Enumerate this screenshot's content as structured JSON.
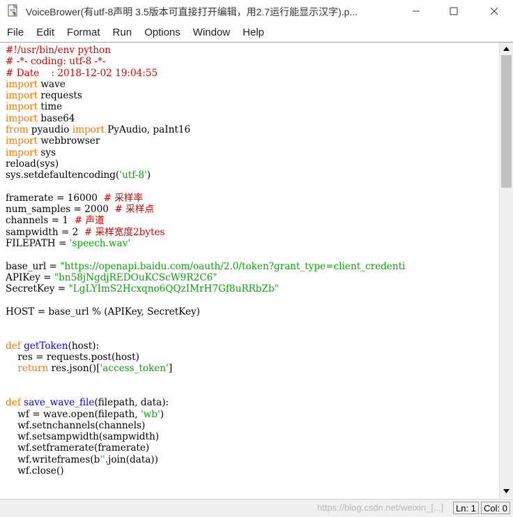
{
  "window": {
    "title": "VoiceBrower(有utf-8声明 3.5版本可直接打开编辑，用2.7运行能显示汉字).p..."
  },
  "menu": [
    "File",
    "Edit",
    "Format",
    "Run",
    "Options",
    "Window",
    "Help"
  ],
  "code_lines": [
    [
      [
        "comment",
        "#!/usr/bin/env python"
      ]
    ],
    [
      [
        "comment",
        "# -*- coding: utf-8 -*-"
      ]
    ],
    [
      [
        "comment",
        "# Date    : 2018-12-02 19:04:55"
      ]
    ],
    [
      [
        "keyword",
        "import"
      ],
      [
        "plain",
        " wave"
      ]
    ],
    [
      [
        "keyword",
        "import"
      ],
      [
        "plain",
        " requests"
      ]
    ],
    [
      [
        "keyword",
        "import"
      ],
      [
        "plain",
        " time"
      ]
    ],
    [
      [
        "keyword",
        "import"
      ],
      [
        "plain",
        " base64"
      ]
    ],
    [
      [
        "keyword",
        "from"
      ],
      [
        "plain",
        " pyaudio "
      ],
      [
        "keyword",
        "import"
      ],
      [
        "plain",
        " PyAudio, paInt16"
      ]
    ],
    [
      [
        "keyword",
        "import"
      ],
      [
        "plain",
        " webbrowser"
      ]
    ],
    [
      [
        "keyword",
        "import"
      ],
      [
        "plain",
        " sys"
      ]
    ],
    [
      [
        "plain",
        "reload(sys)"
      ]
    ],
    [
      [
        "plain",
        "sys.setdefaultencoding("
      ],
      [
        "string",
        "'utf-8'"
      ],
      [
        "plain",
        ")"
      ]
    ],
    [],
    [
      [
        "plain",
        "framerate = 16000  "
      ],
      [
        "comment",
        "# 采样率"
      ]
    ],
    [
      [
        "plain",
        "num_samples = 2000  "
      ],
      [
        "comment",
        "# 采样点"
      ]
    ],
    [
      [
        "plain",
        "channels = 1  "
      ],
      [
        "comment",
        "# 声道"
      ]
    ],
    [
      [
        "plain",
        "sampwidth = 2  "
      ],
      [
        "comment",
        "# 采样宽度2bytes"
      ]
    ],
    [
      [
        "plain",
        "FILEPATH = "
      ],
      [
        "string",
        "'speech.wav'"
      ]
    ],
    [],
    [
      [
        "plain",
        "base_url = "
      ],
      [
        "string",
        "\"https://openapi.baidu.com/oauth/2.0/token?grant_type=client_credenti"
      ]
    ],
    [
      [
        "plain",
        "APIKey = "
      ],
      [
        "string",
        "\"bn58jNgdjREDOuKCScW9R2C6\""
      ]
    ],
    [
      [
        "plain",
        "SecretKey = "
      ],
      [
        "string",
        "\"LgLYImS2Hcxqno6QQzIMrH7Gf8uRRbZb\""
      ]
    ],
    [],
    [
      [
        "plain",
        "HOST = base_url % (APIKey, SecretKey)"
      ]
    ],
    [],
    [],
    [
      [
        "keyword",
        "def"
      ],
      [
        "plain",
        " "
      ],
      [
        "def",
        "getToken"
      ],
      [
        "plain",
        "(host):"
      ]
    ],
    [
      [
        "plain",
        "    res = requests.post(host)"
      ]
    ],
    [
      [
        "plain",
        "    "
      ],
      [
        "keyword",
        "return"
      ],
      [
        "plain",
        " res.json()["
      ],
      [
        "string",
        "'access_token'"
      ],
      [
        "plain",
        "]"
      ]
    ],
    [],
    [],
    [
      [
        "keyword",
        "def"
      ],
      [
        "plain",
        " "
      ],
      [
        "def",
        "save_wave_file"
      ],
      [
        "plain",
        "(filepath, data):"
      ]
    ],
    [
      [
        "plain",
        "    wf = wave.open(filepath, "
      ],
      [
        "string",
        "'wb'"
      ],
      [
        "plain",
        ")"
      ]
    ],
    [
      [
        "plain",
        "    wf.setnchannels(channels)"
      ]
    ],
    [
      [
        "plain",
        "    wf.setsampwidth(sampwidth)"
      ]
    ],
    [
      [
        "plain",
        "    wf.setframerate(framerate)"
      ]
    ],
    [
      [
        "plain",
        "    wf.writeframes(b"
      ],
      [
        "string",
        "''"
      ],
      [
        "plain",
        ".join(data))"
      ]
    ],
    [
      [
        "plain",
        "    wf.close()"
      ]
    ]
  ],
  "status": {
    "line": "Ln: 1",
    "col": "Col: 0",
    "watermark": "https://blog.csdn.net/weixin_[...]"
  },
  "colors": {
    "comment": "#dd0000",
    "keyword": "#ff7700",
    "string": "#00aa00",
    "def": "#0000ff"
  },
  "icons": {
    "app": "idle-file-icon",
    "minimize": "minimize-icon",
    "maximize": "maximize-icon",
    "close": "close-icon",
    "scroll_up": "scroll-up-arrow-icon",
    "scroll_down": "scroll-down-arrow-icon"
  }
}
